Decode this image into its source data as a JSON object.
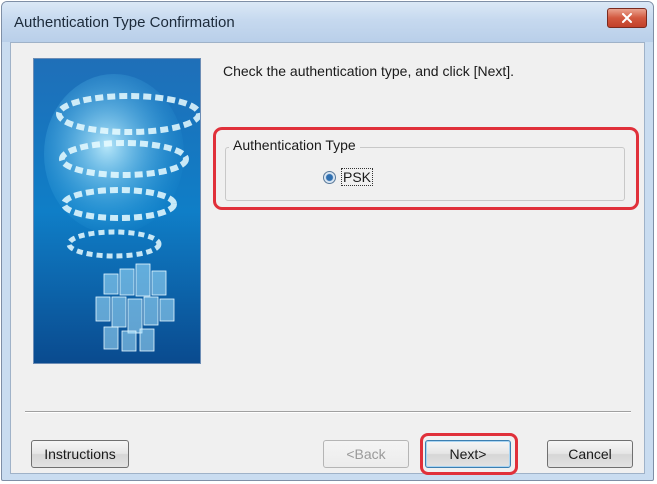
{
  "window": {
    "title": "Authentication Type Confirmation",
    "close_icon": "close-icon"
  },
  "content": {
    "instruction": "Check the authentication type, and click [Next].",
    "group_title": "Authentication Type",
    "radio_option": "PSK",
    "radio_selected": true
  },
  "buttons": {
    "instructions": "Instructions",
    "back": "<Back",
    "next": "Next>",
    "cancel": "Cancel"
  },
  "colors": {
    "highlight": "#e0303a",
    "titlebar": "#c6d9ef"
  }
}
